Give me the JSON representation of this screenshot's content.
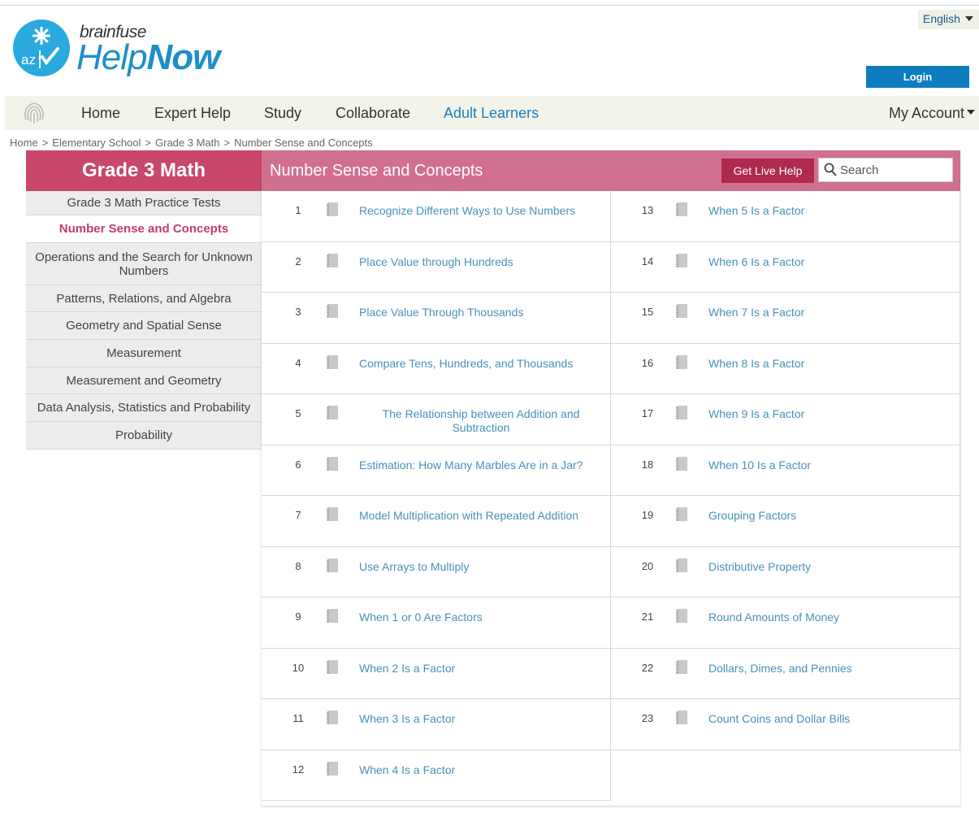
{
  "header": {
    "brand_small": "brainfuse",
    "brand_help": "Help",
    "brand_now": "Now",
    "language": "English",
    "login_label": "Login"
  },
  "nav": {
    "items": [
      {
        "label": "Home"
      },
      {
        "label": "Expert Help"
      },
      {
        "label": "Study"
      },
      {
        "label": "Collaborate"
      },
      {
        "label": "Adult Learners"
      }
    ],
    "account": "My Account"
  },
  "breadcrumb": [
    "Home",
    "Elementary School",
    "Grade 3 Math",
    "Number Sense and Concepts"
  ],
  "breadcrumb_sep": ">",
  "sidebar": {
    "title": "Grade 3 Math",
    "items": [
      {
        "label": "Grade 3 Math Practice Tests"
      },
      {
        "label": "Number Sense and Concepts",
        "active": true
      },
      {
        "label": "Operations and the Search for Unknown Numbers"
      },
      {
        "label": "Patterns, Relations, and Algebra"
      },
      {
        "label": "Geometry and Spatial Sense"
      },
      {
        "label": "Measurement"
      },
      {
        "label": "Measurement and Geometry"
      },
      {
        "label": "Data Analysis, Statistics and Probability"
      },
      {
        "label": "Probability"
      }
    ]
  },
  "main": {
    "title": "Number Sense and Concepts",
    "live_help": "Get Live Help",
    "search_placeholder": "Search"
  },
  "lessons_left": [
    {
      "num": "1",
      "title": "Recognize Different Ways to Use Numbers"
    },
    {
      "num": "2",
      "title": "Place Value through Hundreds"
    },
    {
      "num": "3",
      "title": "Place Value Through Thousands"
    },
    {
      "num": "4",
      "title": "Compare Tens, Hundreds, and Thousands"
    },
    {
      "num": "5",
      "title": "The Relationship between Addition and Subtraction"
    },
    {
      "num": "6",
      "title": "Estimation: How Many Marbles Are in a Jar?"
    },
    {
      "num": "7",
      "title": "Model Multiplication with Repeated Addition"
    },
    {
      "num": "8",
      "title": "Use Arrays to Multiply"
    },
    {
      "num": "9",
      "title": "When 1 or 0 Are Factors"
    },
    {
      "num": "10",
      "title": "When 2 Is a Factor"
    },
    {
      "num": "11",
      "title": "When 3 Is a Factor"
    },
    {
      "num": "12",
      "title": "When 4 Is a Factor"
    }
  ],
  "lessons_right": [
    {
      "num": "13",
      "title": "When 5 Is a Factor"
    },
    {
      "num": "14",
      "title": "When 6 Is a Factor"
    },
    {
      "num": "15",
      "title": "When 7 Is a Factor"
    },
    {
      "num": "16",
      "title": "When 8 Is a Factor"
    },
    {
      "num": "17",
      "title": "When 9 Is a Factor"
    },
    {
      "num": "18",
      "title": "When 10 Is a Factor"
    },
    {
      "num": "19",
      "title": "Grouping Factors"
    },
    {
      "num": "20",
      "title": "Distributive Property"
    },
    {
      "num": "21",
      "title": "Round Amounts of Money"
    },
    {
      "num": "22",
      "title": "Dollars, Dimes, and Pennies"
    },
    {
      "num": "23",
      "title": "Count Coins and Dollar Bills"
    }
  ],
  "colors": {
    "brand_blue": "#1d8fc9",
    "sidebar_head": "#c8476b",
    "main_head": "#d0708e",
    "live_help": "#b02a50",
    "link": "#4a90b8"
  }
}
